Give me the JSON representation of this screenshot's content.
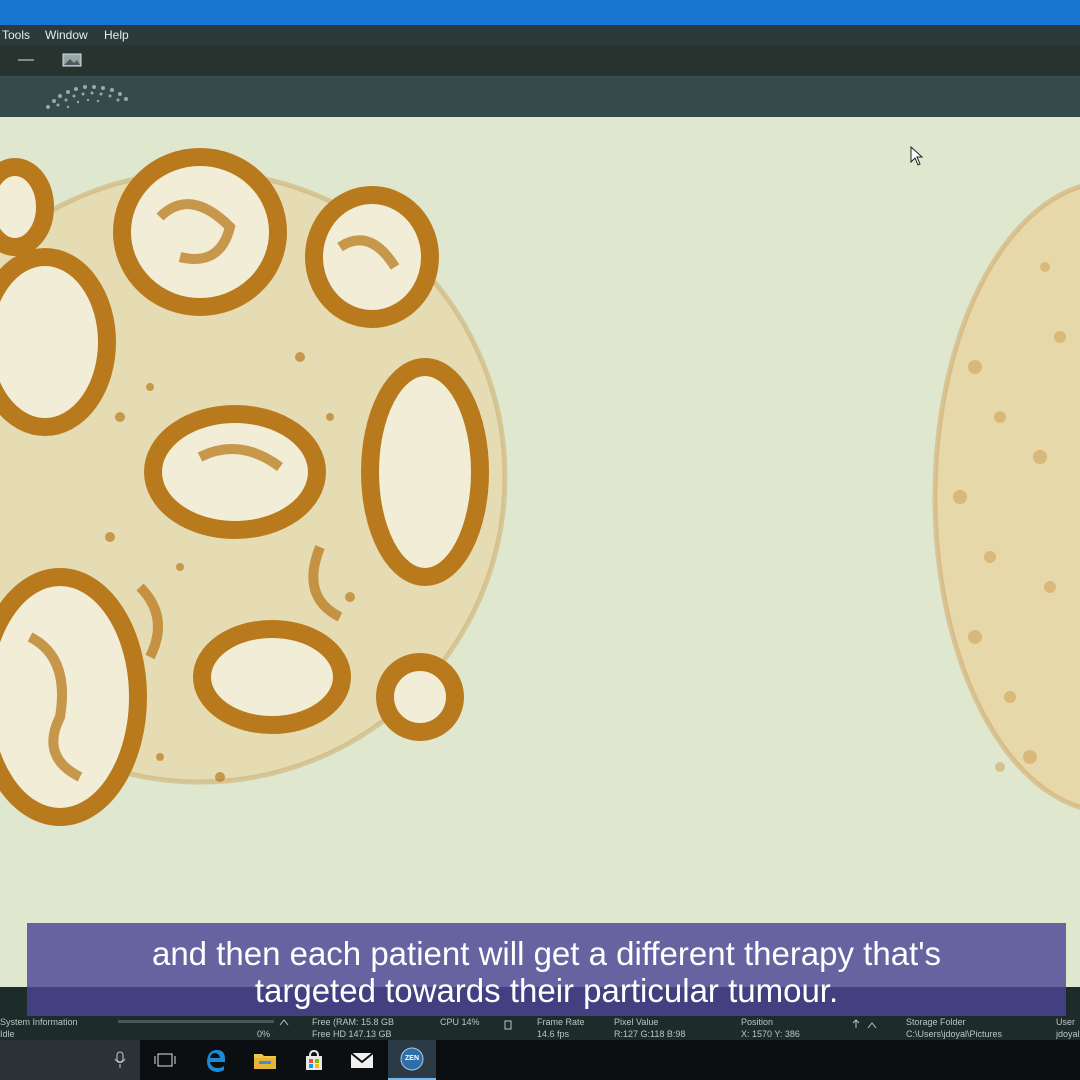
{
  "menu": {
    "items": [
      "Tools",
      "Window",
      "Help"
    ]
  },
  "viewer": {
    "cores": [
      {
        "label": "left-tissue-core"
      },
      {
        "label": "right-tissue-core"
      }
    ]
  },
  "statusbar": {
    "system_information": {
      "label": "System Information",
      "value": "Idle",
      "percent": "0%"
    },
    "memory": {
      "line1": "Free (RAM: 15.8 GB",
      "line2": "Free HD   147.13 GB"
    },
    "cpu": {
      "label": "CPU 14%"
    },
    "frame_rate": {
      "label": "Frame Rate",
      "value": "14.6 fps"
    },
    "pixel_value": {
      "label": "Pixel Value",
      "value": "R:127 G:118 B:98"
    },
    "position": {
      "label": "Position",
      "value": "X: 1570  Y: 386"
    },
    "storage": {
      "label": "Storage Folder",
      "value": "C:\\Users\\jdoyal\\Pictures"
    },
    "user": {
      "label": "User",
      "value": "jdoyal"
    }
  },
  "taskbar": {
    "items": [
      "microphone-icon",
      "task-view-icon",
      "edge-browser-icon",
      "file-explorer-icon",
      "store-icon",
      "mail-icon",
      "zen-app-icon"
    ],
    "zen_label": "ZEN"
  },
  "subtitle": {
    "line1": "and then each patient will get a different therapy that's",
    "line2": "targeted towards their particular tumour."
  },
  "colors": {
    "titlebar": "#1976d2",
    "background": "#dfe8cf",
    "stain": "#b87a1c",
    "subtitle_bg": "#4c4696"
  }
}
